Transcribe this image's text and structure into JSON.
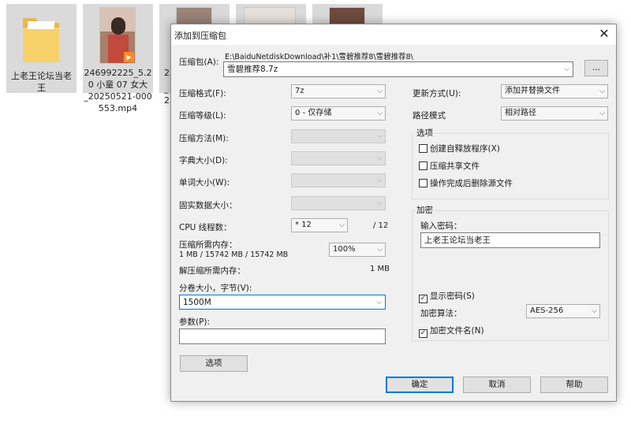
{
  "desktop": {
    "files": [
      {
        "label_line1": "上老王论坛当老",
        "label_line2": "王"
      },
      {
        "label_line1": "246992225_5.2",
        "label_line2": "0 小童 07 女大",
        "label_line3": "_20250521-000",
        "label_line4": "553.mp4"
      },
      {
        "label_line1": "2"
      },
      {
        "label_line1": ""
      },
      {
        "label_line1": ""
      }
    ],
    "peek_letters": [
      "_",
      "2"
    ]
  },
  "dialog": {
    "title": "添加到压缩包",
    "close_glyph": "✕",
    "archive_label": "压缩包(A):",
    "archive_path": "E:\\BaiduNetdiskDownload\\补1\\雪碧推荐8\\雪碧推荐8\\",
    "archive_name": "雪碧推荐8.7z",
    "browse_label": "...",
    "format_label": "压缩格式(F):",
    "format_value": "7z",
    "level_label": "压缩等级(L):",
    "level_value": "0 - 仅存储",
    "method_label": "压缩方法(M):",
    "dict_label": "字典大小(D):",
    "word_label": "单词大小(W):",
    "solid_label": "固实数据大小：",
    "cpu_label": "CPU 线程数：",
    "cpu_value": "* 12",
    "cpu_max": "/ 12",
    "mem_comp_label": "压缩所需内存：",
    "mem_comp_value": "1 MB / 15742 MB / 15742 MB",
    "mem_percent": "100%",
    "mem_decomp_label": "解压缩所需内存：",
    "mem_decomp_value": "1 MB",
    "split_label": "分卷大小，字节(V):",
    "split_value": "1500M",
    "params_label": "参数(P):",
    "params_value": "",
    "options_button": "选项",
    "update_label": "更新方式(U):",
    "update_value": "添加并替换文件",
    "path_label": "路径模式",
    "path_value": "相对路径",
    "options_group": {
      "title": "选项",
      "sfx": "创建自释放程序(X)",
      "shared": "压缩共享文件",
      "delete": "操作完成后删除源文件"
    },
    "encrypt_group": {
      "title": "加密",
      "pwd_label": "输入密码：",
      "pwd_value": "上老王论坛当老王",
      "show_pwd": "显示密码(S)",
      "algo_label": "加密算法：",
      "algo_value": "AES-256",
      "enc_names": "加密文件名(N)",
      "check_glyph": "✓"
    },
    "ok": "确定",
    "cancel": "取消",
    "help": "帮助",
    "dropdown_arrow": "⌵"
  }
}
